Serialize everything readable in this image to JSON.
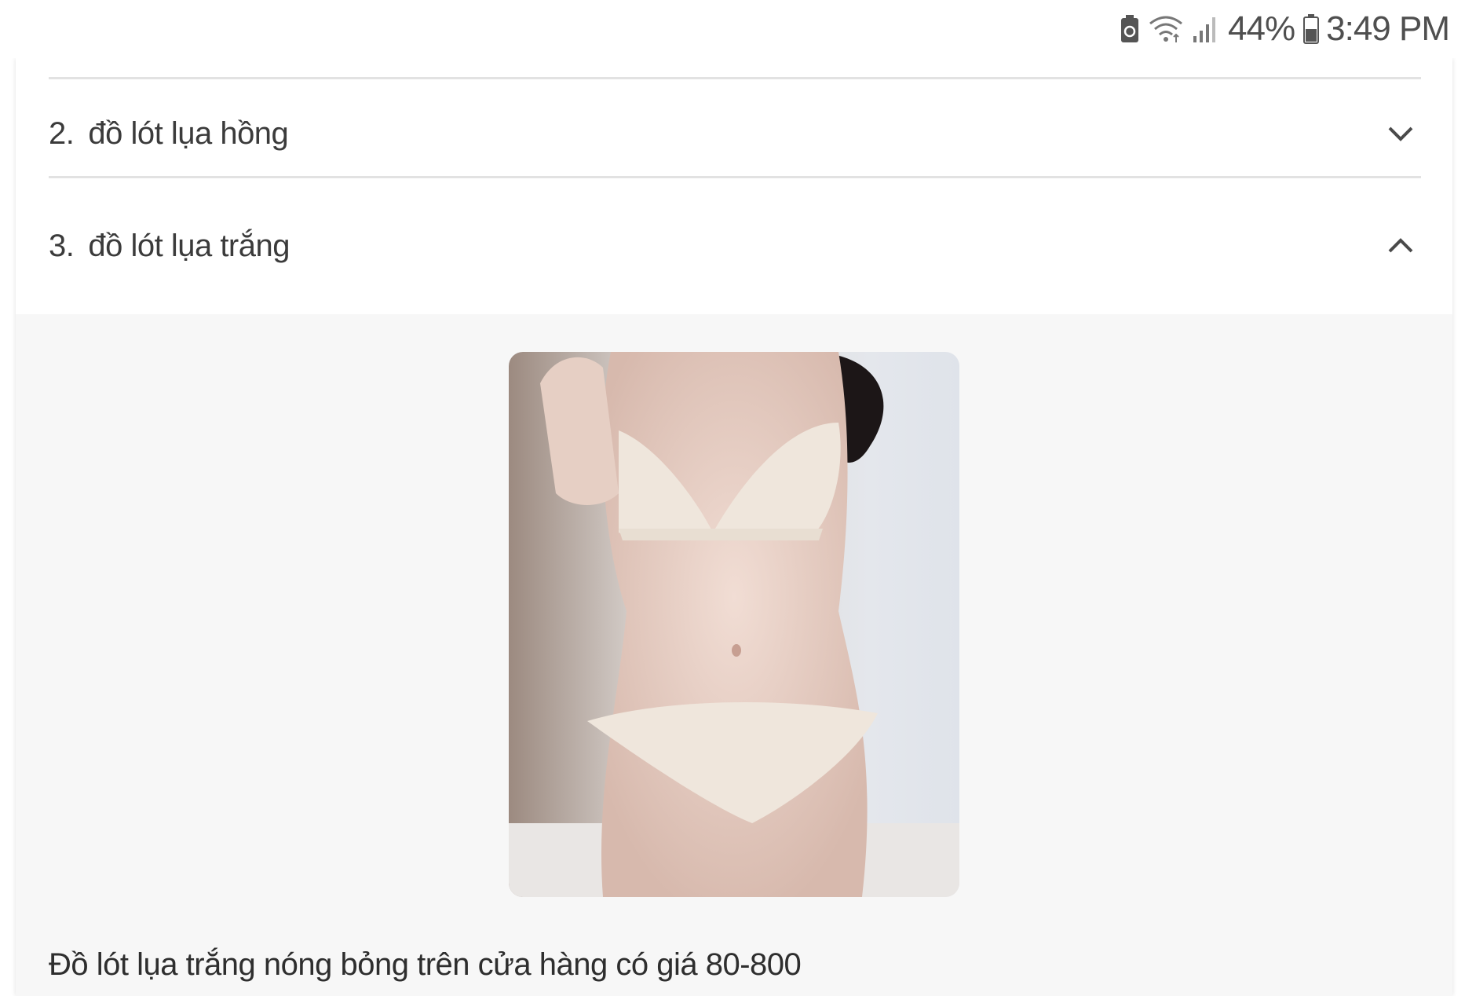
{
  "status_bar": {
    "battery_percent": "44%",
    "time": "3:49 PM",
    "icons": [
      "battery-saver-icon",
      "wifi-icon",
      "signal-icon",
      "battery-icon"
    ]
  },
  "accordion": {
    "items": [
      {
        "number": "2.",
        "title": "đồ lót lụa hồng",
        "expanded": false,
        "chevron": "chevron-down-icon"
      },
      {
        "number": "3.",
        "title": "đồ lót lụa trắng",
        "expanded": true,
        "chevron": "chevron-up-icon"
      }
    ],
    "expanded_panel": {
      "image_alt": "white silk lingerie product photo",
      "caption": "Đồ lót lụa trắng nóng bỏng trên cửa hàng có giá 80-800"
    }
  },
  "colors": {
    "panel_background": "#f7f7f7",
    "divider": "#e2e2e2",
    "text": "#3b3b3b"
  }
}
